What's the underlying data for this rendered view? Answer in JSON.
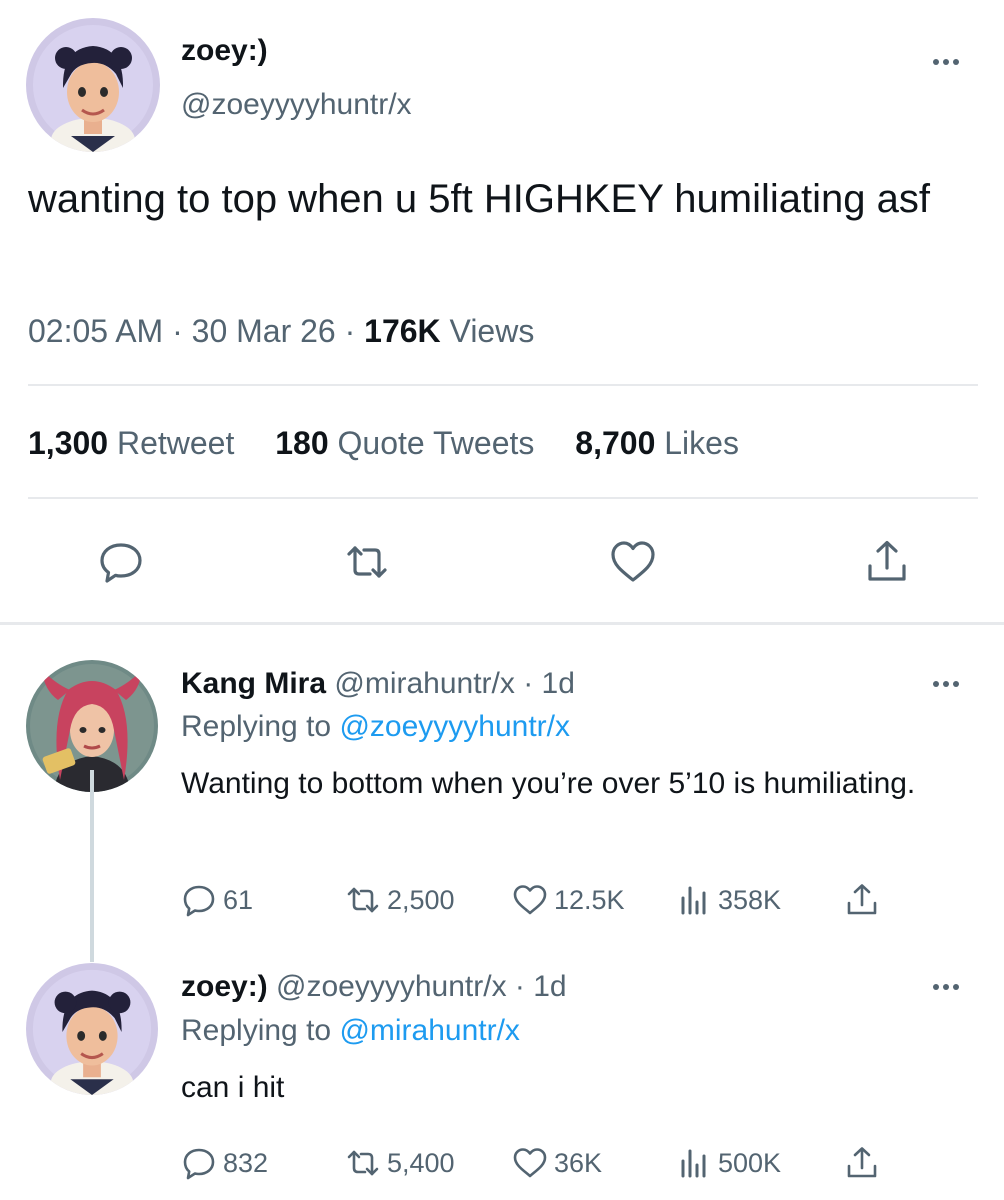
{
  "main": {
    "display_name": "zoey:)",
    "handle": "@zoeyyyyhuntr/x",
    "text": "wanting to top when u 5ft HIGHKEY humiliating asf",
    "time": "02:05 AM",
    "date": "30 Mar 26",
    "views_count": "176K",
    "views_label": "Views",
    "stats": {
      "retweets_count": "1,300",
      "retweets_label": "Retweet",
      "quotes_count": "180",
      "quotes_label": "Quote Tweets",
      "likes_count": "8,700",
      "likes_label": "Likes"
    },
    "actions": [
      "reply-icon",
      "retweet-icon",
      "like-icon",
      "share-icon"
    ]
  },
  "replies": [
    {
      "display_name": "Kang Mira",
      "handle": "@mirahuntr/x",
      "age": "1d",
      "replying_prefix": "Replying to",
      "replying_to": "@zoeyyyyhuntr/x",
      "text": "Wanting to bottom when you’re over 5’10 is humiliating.",
      "replies": "61",
      "retweets": "2,500",
      "likes": "12.5K",
      "views": "358K"
    },
    {
      "display_name": "zoey:)",
      "handle": "@zoeyyyyhuntr/x",
      "age": "1d",
      "replying_prefix": "Replying to",
      "replying_to": "@mirahuntr/x",
      "text": "can i hit",
      "replies": "832",
      "retweets": "5,400",
      "likes": "36K",
      "views": "500K"
    }
  ],
  "colors": {
    "text": "#0f1419",
    "secondary": "#536471",
    "link": "#1d9bf0",
    "divider": "#e7e9ec"
  }
}
